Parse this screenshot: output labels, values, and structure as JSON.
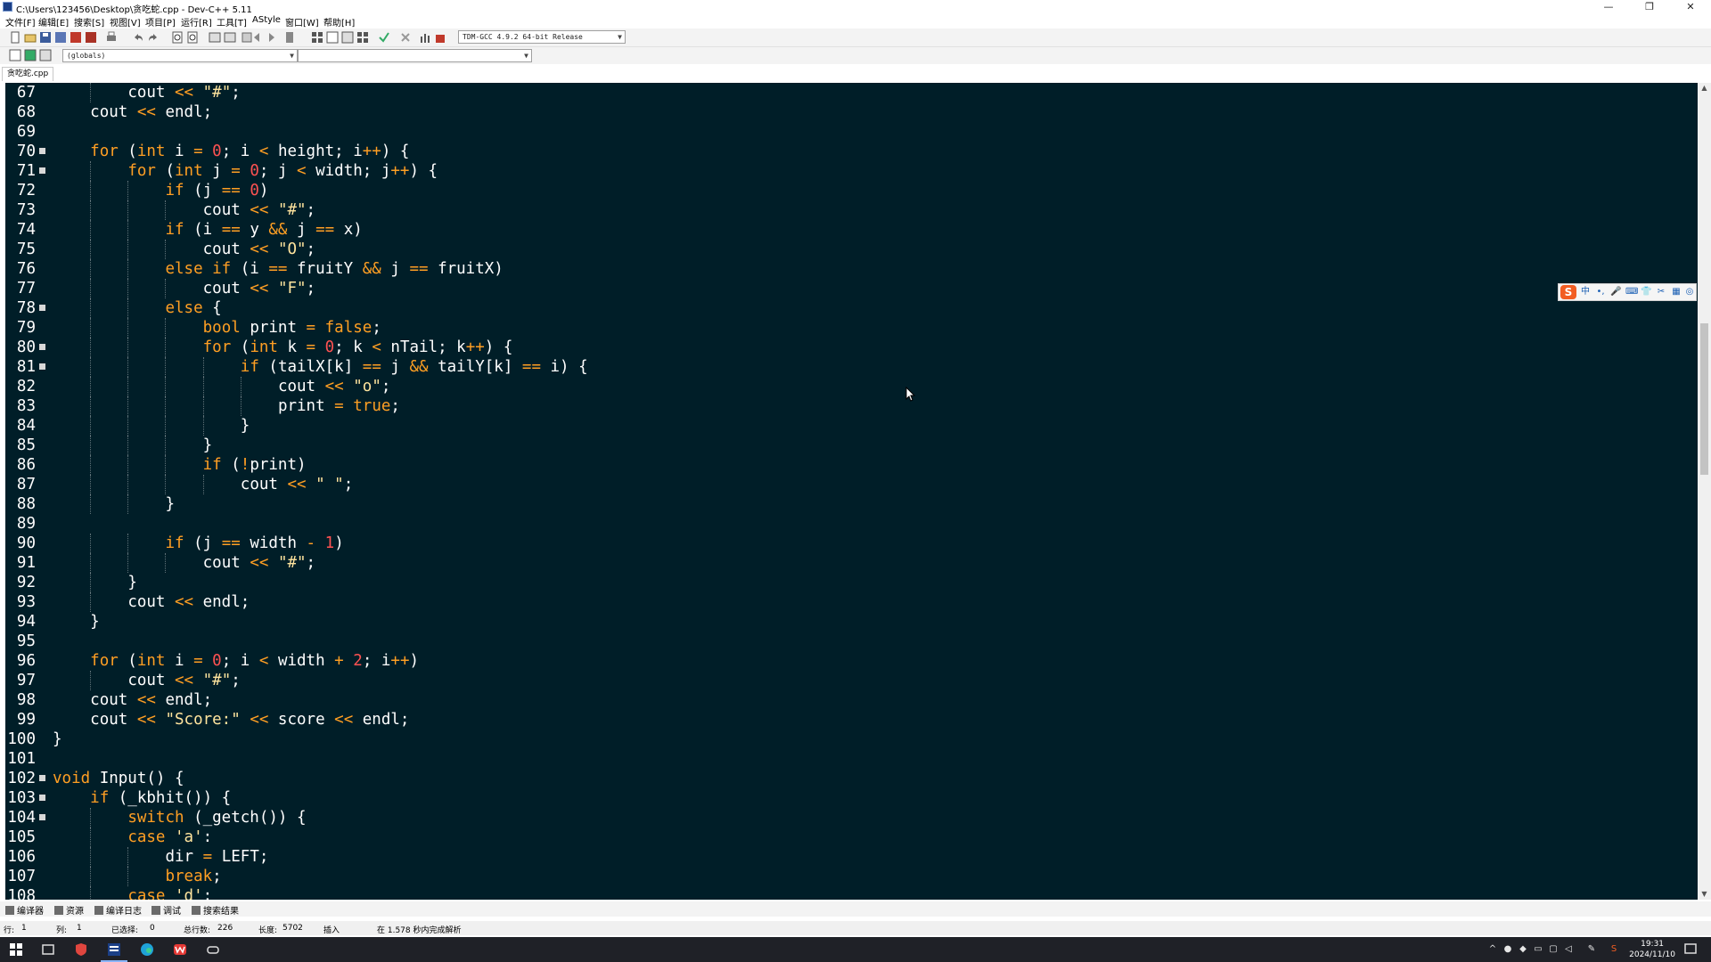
{
  "window": {
    "title": "C:\\Users\\123456\\Desktop\\贪吃蛇.cpp - Dev-C++ 5.11",
    "minimize": "—",
    "restore": "❐",
    "close": "✕"
  },
  "menu": [
    "文件[F]",
    "编辑[E]",
    "搜索[S]",
    "视图[V]",
    "项目[P]",
    "运行[R]",
    "工具[T]",
    "AStyle",
    "窗口[W]",
    "帮助[H]"
  ],
  "toolbar": {
    "compiler_select": "TDM-GCC 4.9.2 64-bit Release",
    "scope_select": "(globals)",
    "member_select": ""
  },
  "file_tab": "贪吃蛇.cpp",
  "editor": {
    "background": "#001e28",
    "lines": [
      {
        "n": "67",
        "fold": false,
        "indent": 2,
        "tokens": [
          [
            "t-plain",
            "cout "
          ],
          [
            "t-op",
            "<<"
          ],
          [
            "t-plain",
            " "
          ],
          [
            "t-str",
            "\"#\""
          ],
          [
            "t-plain",
            ";"
          ]
        ]
      },
      {
        "n": "68",
        "fold": false,
        "indent": 1,
        "tokens": [
          [
            "t-plain",
            "cout "
          ],
          [
            "t-op",
            "<<"
          ],
          [
            "t-plain",
            " endl;"
          ]
        ]
      },
      {
        "n": "69",
        "fold": false,
        "indent": 0,
        "tokens": []
      },
      {
        "n": "70",
        "fold": true,
        "indent": 1,
        "tokens": [
          [
            "t-kw",
            "for"
          ],
          [
            "t-plain",
            " ("
          ],
          [
            "t-kw",
            "int"
          ],
          [
            "t-plain",
            " i "
          ],
          [
            "t-op",
            "="
          ],
          [
            "t-plain",
            " "
          ],
          [
            "t-num",
            "0"
          ],
          [
            "t-plain",
            "; i "
          ],
          [
            "t-op",
            "<"
          ],
          [
            "t-plain",
            " height; i"
          ],
          [
            "t-op",
            "++"
          ],
          [
            "t-plain",
            ") {"
          ]
        ]
      },
      {
        "n": "71",
        "fold": true,
        "indent": 2,
        "tokens": [
          [
            "t-kw",
            "for"
          ],
          [
            "t-plain",
            " ("
          ],
          [
            "t-kw",
            "int"
          ],
          [
            "t-plain",
            " j "
          ],
          [
            "t-op",
            "="
          ],
          [
            "t-plain",
            " "
          ],
          [
            "t-num",
            "0"
          ],
          [
            "t-plain",
            "; j "
          ],
          [
            "t-op",
            "<"
          ],
          [
            "t-plain",
            " width; j"
          ],
          [
            "t-op",
            "++"
          ],
          [
            "t-plain",
            ") {"
          ]
        ]
      },
      {
        "n": "72",
        "fold": false,
        "indent": 3,
        "tokens": [
          [
            "t-kw",
            "if"
          ],
          [
            "t-plain",
            " (j "
          ],
          [
            "t-op",
            "=="
          ],
          [
            "t-plain",
            " "
          ],
          [
            "t-num",
            "0"
          ],
          [
            "t-plain",
            ")"
          ]
        ]
      },
      {
        "n": "73",
        "fold": false,
        "indent": 4,
        "tokens": [
          [
            "t-plain",
            "cout "
          ],
          [
            "t-op",
            "<<"
          ],
          [
            "t-plain",
            " "
          ],
          [
            "t-str",
            "\"#\""
          ],
          [
            "t-plain",
            ";"
          ]
        ]
      },
      {
        "n": "74",
        "fold": false,
        "indent": 3,
        "tokens": [
          [
            "t-kw",
            "if"
          ],
          [
            "t-plain",
            " (i "
          ],
          [
            "t-op",
            "=="
          ],
          [
            "t-plain",
            " y "
          ],
          [
            "t-op",
            "&&"
          ],
          [
            "t-plain",
            " j "
          ],
          [
            "t-op",
            "=="
          ],
          [
            "t-plain",
            " x)"
          ]
        ]
      },
      {
        "n": "75",
        "fold": false,
        "indent": 4,
        "tokens": [
          [
            "t-plain",
            "cout "
          ],
          [
            "t-op",
            "<<"
          ],
          [
            "t-plain",
            " "
          ],
          [
            "t-str",
            "\"O\""
          ],
          [
            "t-plain",
            ";"
          ]
        ]
      },
      {
        "n": "76",
        "fold": false,
        "indent": 3,
        "tokens": [
          [
            "t-kw",
            "else if"
          ],
          [
            "t-plain",
            " (i "
          ],
          [
            "t-op",
            "=="
          ],
          [
            "t-plain",
            " fruitY "
          ],
          [
            "t-op",
            "&&"
          ],
          [
            "t-plain",
            " j "
          ],
          [
            "t-op",
            "=="
          ],
          [
            "t-plain",
            " fruitX)"
          ]
        ]
      },
      {
        "n": "77",
        "fold": false,
        "indent": 4,
        "tokens": [
          [
            "t-plain",
            "cout "
          ],
          [
            "t-op",
            "<<"
          ],
          [
            "t-plain",
            " "
          ],
          [
            "t-str",
            "\"F\""
          ],
          [
            "t-plain",
            ";"
          ]
        ]
      },
      {
        "n": "78",
        "fold": true,
        "indent": 3,
        "tokens": [
          [
            "t-kw",
            "else"
          ],
          [
            "t-plain",
            " {"
          ]
        ]
      },
      {
        "n": "79",
        "fold": false,
        "indent": 4,
        "tokens": [
          [
            "t-kw",
            "bool"
          ],
          [
            "t-plain",
            " print "
          ],
          [
            "t-op",
            "="
          ],
          [
            "t-plain",
            " "
          ],
          [
            "t-kw",
            "false"
          ],
          [
            "t-plain",
            ";"
          ]
        ]
      },
      {
        "n": "80",
        "fold": true,
        "indent": 4,
        "tokens": [
          [
            "t-kw",
            "for"
          ],
          [
            "t-plain",
            " ("
          ],
          [
            "t-kw",
            "int"
          ],
          [
            "t-plain",
            " k "
          ],
          [
            "t-op",
            "="
          ],
          [
            "t-plain",
            " "
          ],
          [
            "t-num",
            "0"
          ],
          [
            "t-plain",
            "; k "
          ],
          [
            "t-op",
            "<"
          ],
          [
            "t-plain",
            " nTail; k"
          ],
          [
            "t-op",
            "++"
          ],
          [
            "t-plain",
            ") {"
          ]
        ]
      },
      {
        "n": "81",
        "fold": true,
        "indent": 5,
        "tokens": [
          [
            "t-kw",
            "if"
          ],
          [
            "t-plain",
            " (tailX[k] "
          ],
          [
            "t-op",
            "=="
          ],
          [
            "t-plain",
            " j "
          ],
          [
            "t-op",
            "&&"
          ],
          [
            "t-plain",
            " tailY[k] "
          ],
          [
            "t-op",
            "=="
          ],
          [
            "t-plain",
            " i) {"
          ]
        ]
      },
      {
        "n": "82",
        "fold": false,
        "indent": 6,
        "tokens": [
          [
            "t-plain",
            "cout "
          ],
          [
            "t-op",
            "<<"
          ],
          [
            "t-plain",
            " "
          ],
          [
            "t-str",
            "\"o\""
          ],
          [
            "t-plain",
            ";"
          ]
        ]
      },
      {
        "n": "83",
        "fold": false,
        "indent": 6,
        "tokens": [
          [
            "t-plain",
            "print "
          ],
          [
            "t-op",
            "="
          ],
          [
            "t-plain",
            " "
          ],
          [
            "t-kw",
            "true"
          ],
          [
            "t-plain",
            ";"
          ]
        ]
      },
      {
        "n": "84",
        "fold": false,
        "indent": 5,
        "tokens": [
          [
            "t-plain",
            "}"
          ]
        ]
      },
      {
        "n": "85",
        "fold": false,
        "indent": 4,
        "tokens": [
          [
            "t-plain",
            "}"
          ]
        ]
      },
      {
        "n": "86",
        "fold": false,
        "indent": 4,
        "tokens": [
          [
            "t-kw",
            "if"
          ],
          [
            "t-plain",
            " ("
          ],
          [
            "t-op",
            "!"
          ],
          [
            "t-plain",
            "print)"
          ]
        ]
      },
      {
        "n": "87",
        "fold": false,
        "indent": 5,
        "tokens": [
          [
            "t-plain",
            "cout "
          ],
          [
            "t-op",
            "<<"
          ],
          [
            "t-plain",
            " "
          ],
          [
            "t-str",
            "\" \""
          ],
          [
            "t-plain",
            ";"
          ]
        ]
      },
      {
        "n": "88",
        "fold": false,
        "indent": 3,
        "tokens": [
          [
            "t-plain",
            "}"
          ]
        ]
      },
      {
        "n": "89",
        "fold": false,
        "indent": 0,
        "tokens": []
      },
      {
        "n": "90",
        "fold": false,
        "indent": 3,
        "tokens": [
          [
            "t-kw",
            "if"
          ],
          [
            "t-plain",
            " (j "
          ],
          [
            "t-op",
            "=="
          ],
          [
            "t-plain",
            " width "
          ],
          [
            "t-op",
            "-"
          ],
          [
            "t-plain",
            " "
          ],
          [
            "t-num",
            "1"
          ],
          [
            "t-plain",
            ")"
          ]
        ]
      },
      {
        "n": "91",
        "fold": false,
        "indent": 4,
        "tokens": [
          [
            "t-plain",
            "cout "
          ],
          [
            "t-op",
            "<<"
          ],
          [
            "t-plain",
            " "
          ],
          [
            "t-str",
            "\"#\""
          ],
          [
            "t-plain",
            ";"
          ]
        ]
      },
      {
        "n": "92",
        "fold": false,
        "indent": 2,
        "tokens": [
          [
            "t-plain",
            "}"
          ]
        ]
      },
      {
        "n": "93",
        "fold": false,
        "indent": 2,
        "tokens": [
          [
            "t-plain",
            "cout "
          ],
          [
            "t-op",
            "<<"
          ],
          [
            "t-plain",
            " endl;"
          ]
        ]
      },
      {
        "n": "94",
        "fold": false,
        "indent": 1,
        "tokens": [
          [
            "t-plain",
            "}"
          ]
        ]
      },
      {
        "n": "95",
        "fold": false,
        "indent": 0,
        "tokens": []
      },
      {
        "n": "96",
        "fold": false,
        "indent": 1,
        "tokens": [
          [
            "t-kw",
            "for"
          ],
          [
            "t-plain",
            " ("
          ],
          [
            "t-kw",
            "int"
          ],
          [
            "t-plain",
            " i "
          ],
          [
            "t-op",
            "="
          ],
          [
            "t-plain",
            " "
          ],
          [
            "t-num",
            "0"
          ],
          [
            "t-plain",
            "; i "
          ],
          [
            "t-op",
            "<"
          ],
          [
            "t-plain",
            " width "
          ],
          [
            "t-op",
            "+"
          ],
          [
            "t-plain",
            " "
          ],
          [
            "t-num",
            "2"
          ],
          [
            "t-plain",
            "; i"
          ],
          [
            "t-op",
            "++"
          ],
          [
            "t-plain",
            ")"
          ]
        ]
      },
      {
        "n": "97",
        "fold": false,
        "indent": 2,
        "tokens": [
          [
            "t-plain",
            "cout "
          ],
          [
            "t-op",
            "<<"
          ],
          [
            "t-plain",
            " "
          ],
          [
            "t-str",
            "\"#\""
          ],
          [
            "t-plain",
            ";"
          ]
        ]
      },
      {
        "n": "98",
        "fold": false,
        "indent": 1,
        "tokens": [
          [
            "t-plain",
            "cout "
          ],
          [
            "t-op",
            "<<"
          ],
          [
            "t-plain",
            " endl;"
          ]
        ]
      },
      {
        "n": "99",
        "fold": false,
        "indent": 1,
        "tokens": [
          [
            "t-plain",
            "cout "
          ],
          [
            "t-op",
            "<<"
          ],
          [
            "t-plain",
            " "
          ],
          [
            "t-str",
            "\"Score:\""
          ],
          [
            "t-plain",
            " "
          ],
          [
            "t-op",
            "<<"
          ],
          [
            "t-plain",
            " score "
          ],
          [
            "t-op",
            "<<"
          ],
          [
            "t-plain",
            " endl;"
          ]
        ]
      },
      {
        "n": "100",
        "fold": false,
        "indent": 0,
        "tokens": [
          [
            "t-plain",
            "}"
          ]
        ]
      },
      {
        "n": "101",
        "fold": false,
        "indent": 0,
        "tokens": []
      },
      {
        "n": "102",
        "fold": true,
        "indent": 0,
        "tokens": [
          [
            "t-kw",
            "void"
          ],
          [
            "t-plain",
            " Input() {"
          ]
        ]
      },
      {
        "n": "103",
        "fold": true,
        "indent": 1,
        "tokens": [
          [
            "t-kw",
            "if"
          ],
          [
            "t-plain",
            " (_kbhit()) {"
          ]
        ]
      },
      {
        "n": "104",
        "fold": true,
        "indent": 2,
        "tokens": [
          [
            "t-kw",
            "switch"
          ],
          [
            "t-plain",
            " (_getch()) {"
          ]
        ]
      },
      {
        "n": "105",
        "fold": false,
        "indent": 2,
        "tokens": [
          [
            "t-kw",
            "case"
          ],
          [
            "t-plain",
            " "
          ],
          [
            "t-str",
            "'a'"
          ],
          [
            "t-plain",
            ":"
          ]
        ]
      },
      {
        "n": "106",
        "fold": false,
        "indent": 3,
        "tokens": [
          [
            "t-plain",
            "dir "
          ],
          [
            "t-op",
            "="
          ],
          [
            "t-plain",
            " LEFT;"
          ]
        ]
      },
      {
        "n": "107",
        "fold": false,
        "indent": 3,
        "tokens": [
          [
            "t-kw",
            "break"
          ],
          [
            "t-plain",
            ";"
          ]
        ]
      },
      {
        "n": "108",
        "fold": false,
        "indent": 2,
        "tokens": [
          [
            "t-kw",
            "case"
          ],
          [
            "t-plain",
            " "
          ],
          [
            "t-str",
            "'d'"
          ],
          [
            "t-plain",
            ":"
          ]
        ]
      }
    ]
  },
  "bottom_tabs": [
    "编译器",
    "资源",
    "编译日志",
    "调试",
    "搜索结果"
  ],
  "status": {
    "row_label": "行:",
    "row": "1",
    "col_label": "列:",
    "col": "1",
    "sel_label": "已选择:",
    "sel": "0",
    "total_label": "总行数:",
    "total": "226",
    "len_label": "长度:",
    "len": "5702",
    "mode": "插入",
    "parse": "在 1.578 秒内完成解析"
  },
  "taskbar": {
    "time": "19:31",
    "date": "2024/11/10"
  },
  "ime": {
    "logo": "S",
    "mode": "中"
  }
}
